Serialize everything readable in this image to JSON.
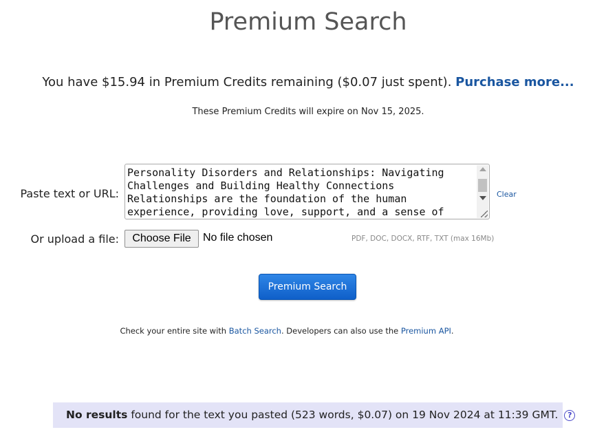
{
  "page": {
    "title": "Premium Search"
  },
  "credits": {
    "prefix": "You have $15.94 in Premium Credits remaining ($0.07 just spent).",
    "purchase_link": "Purchase more...",
    "expiry": "These Premium Credits will expire on Nov 15, 2025."
  },
  "form": {
    "paste_label": "Paste text or URL:",
    "textarea_value": "Personality Disorders and Relationships: Navigating Challenges and Building Healthy Connections\nRelationships are the foundation of the human experience, providing love, support, and a sense of",
    "clear_link": "Clear",
    "upload_label": "Or upload a file:",
    "choose_file_button": "Choose File",
    "no_file_text": "No file chosen",
    "formats_hint": "PDF, DOC, DOCX, RTF, TXT (max 16Mb)",
    "search_button": "Premium Search"
  },
  "batch": {
    "text_before": "Check your entire site with ",
    "batch_link": "Batch Search",
    "text_middle": ". Developers can also use the ",
    "api_link": "Premium API",
    "text_after": "."
  },
  "results": {
    "bold": "No results",
    "rest": " found for the text you pasted (523 words, $0.07) on 19 Nov 2024 at 11:39 GMT.",
    "help_icon_glyph": "?"
  },
  "colors": {
    "link": "#1a56a0",
    "button": "#1565d8",
    "results_bg": "#e3e3f7",
    "help_icon": "#4a49c9"
  }
}
